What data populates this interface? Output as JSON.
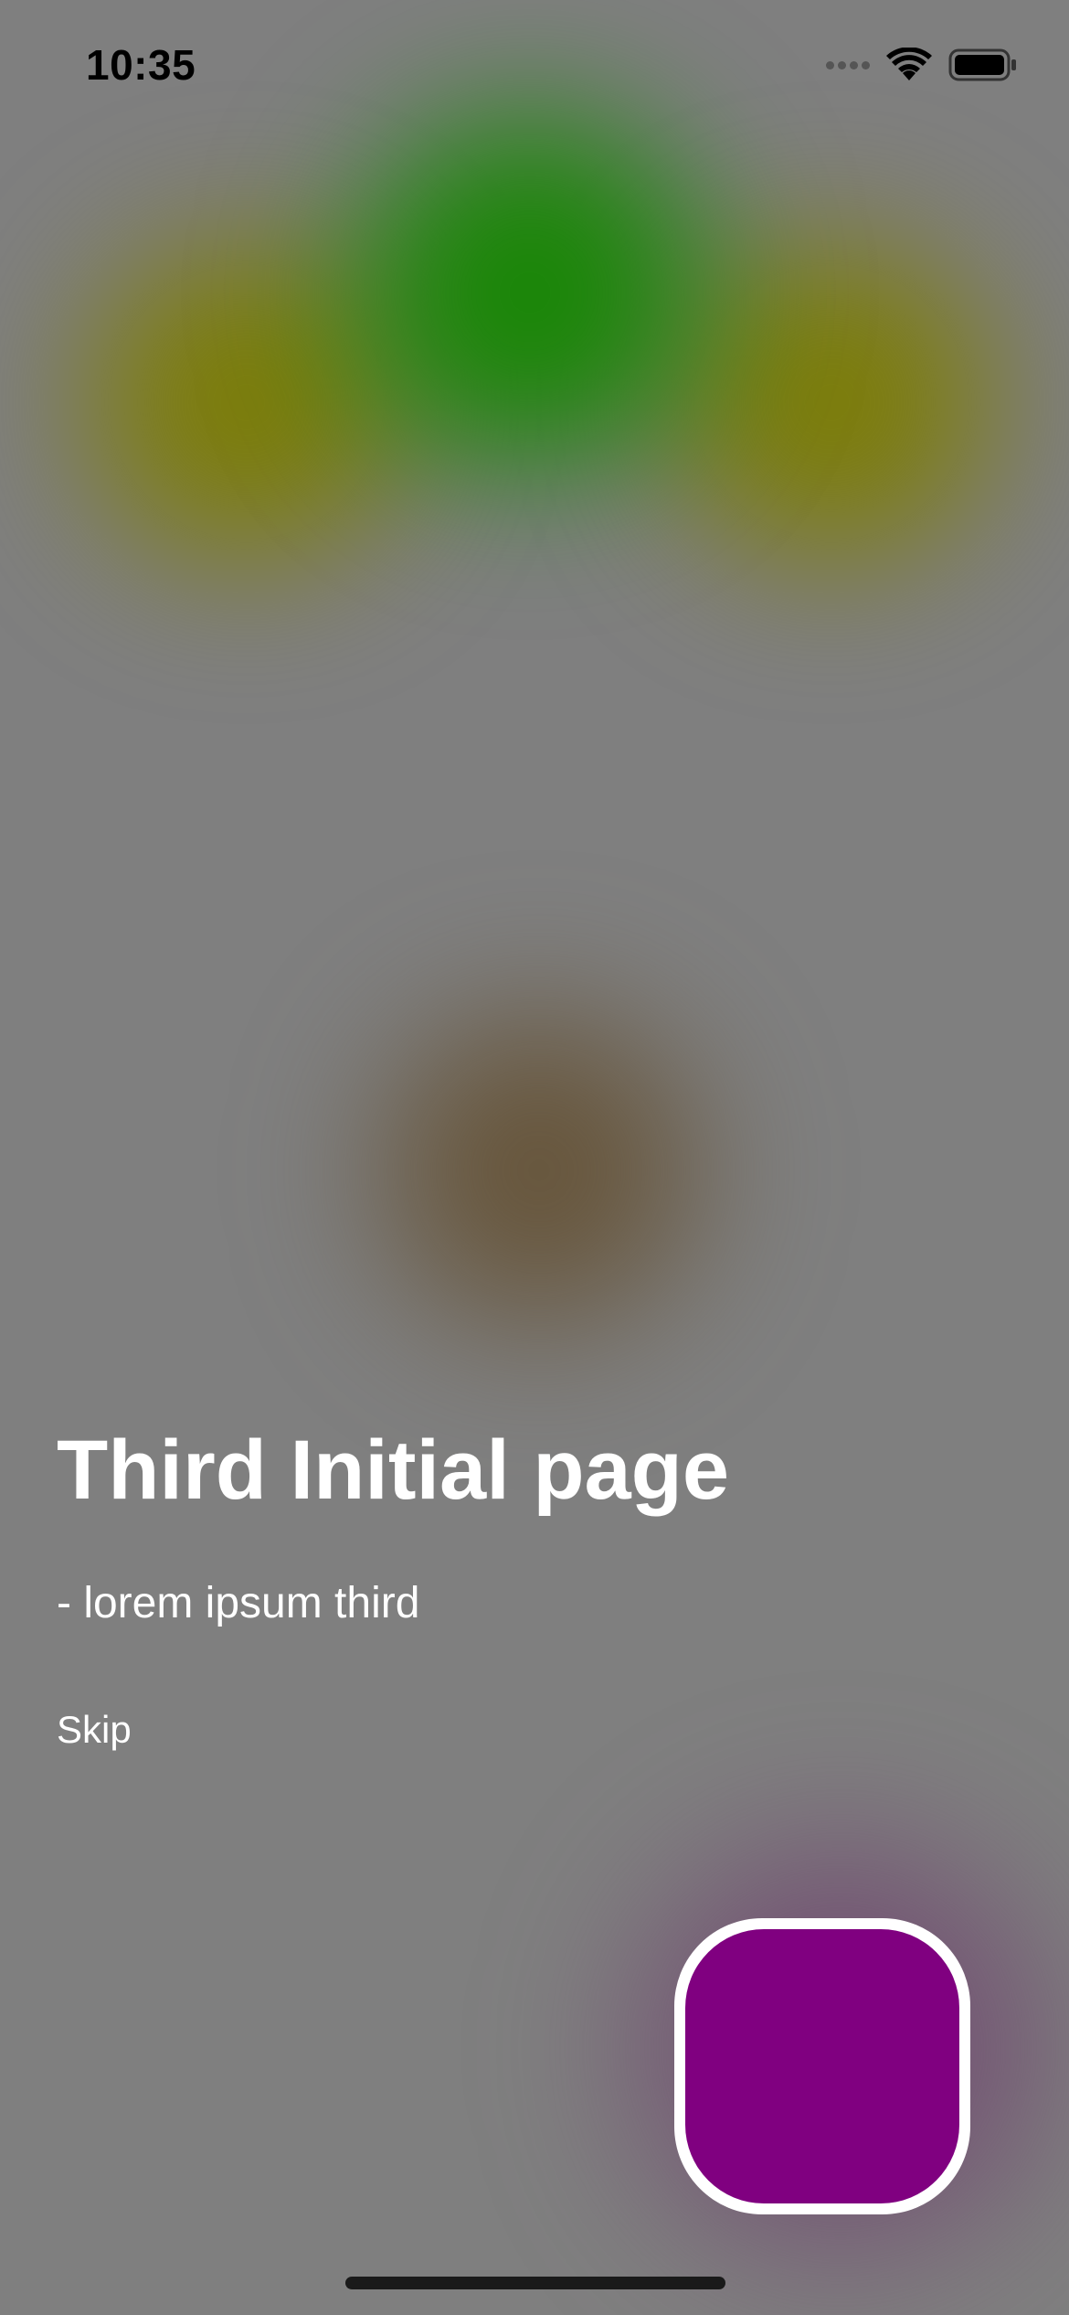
{
  "status_bar": {
    "time": "10:35",
    "icons": [
      "signal-dots-icon",
      "wifi-icon",
      "battery-icon"
    ]
  },
  "onboarding": {
    "title": "Third Initial page",
    "subtitle": "- lorem ipsum third",
    "skip_label": "Skip"
  },
  "colors": {
    "background": "#7f7f7f",
    "blob_yellow": "#7d7d00",
    "blob_green": "#148700",
    "blob_brown": "#645032",
    "action_button": "#800080",
    "text": "#ffffff"
  }
}
